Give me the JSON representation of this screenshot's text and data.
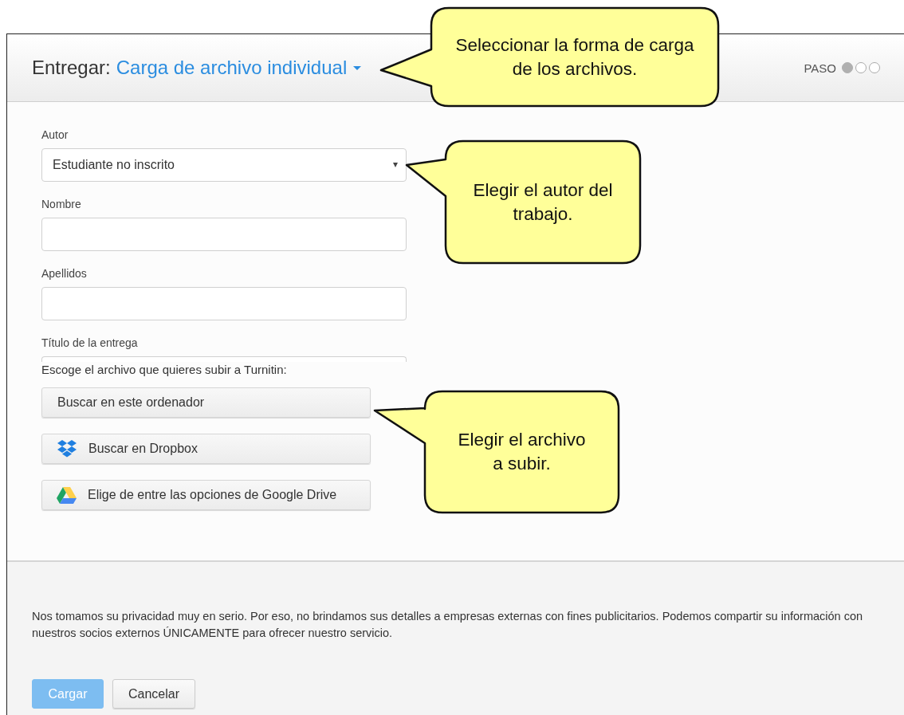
{
  "header": {
    "prefix": "Entregar:",
    "mode": "Carga de archivo individual",
    "steps_label": "PASO",
    "steps": [
      {
        "selected": true
      },
      {
        "selected": false
      },
      {
        "selected": false
      }
    ]
  },
  "form": {
    "fields": [
      {
        "kind": "select",
        "label": "Autor",
        "value": "Estudiante no inscrito"
      },
      {
        "kind": "input",
        "label": "Nombre"
      },
      {
        "kind": "input",
        "label": "Apellidos"
      },
      {
        "kind": "partial",
        "label": "Título de la entrega"
      }
    ],
    "file_prompt": "Escoge el archivo que quieres subir a Turnitin:",
    "file_buttons": [
      {
        "kind": "computer",
        "label": "Buscar en este ordenador"
      },
      {
        "kind": "dropbox",
        "label": "Buscar en Dropbox"
      },
      {
        "kind": "drive",
        "label": "Elige de entre las opciones de Google Drive"
      }
    ]
  },
  "footer": {
    "privacy_text": "Nos tomamos su privacidad muy en serio. Por eso, no brindamos sus detalles a empresas externas con fines publicitarios. Podemos compartir su información con nuestros socios externos ÚNICAMENTE para ofrecer nuestro servicio.",
    "buttons": [
      {
        "kind": "primary",
        "label": "Cargar",
        "disabled": true
      },
      {
        "kind": "secondary",
        "label": "Cancelar",
        "disabled": false
      }
    ]
  },
  "callouts": [
    {
      "text": "Seleccionar la forma de carga de los archivos."
    },
    {
      "text": "Elegir el autor del trabajo."
    },
    {
      "text": "Elegir el archivo a subir."
    }
  ]
}
